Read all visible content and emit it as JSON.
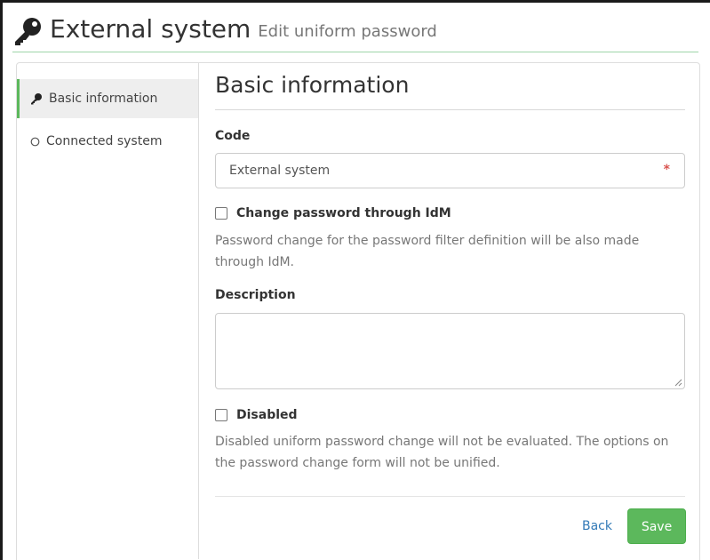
{
  "header": {
    "title": "External system",
    "subtitle": "Edit uniform password",
    "icon": "key-icon"
  },
  "sidebar": {
    "items": [
      {
        "label": "Basic information",
        "icon": "key-icon",
        "active": true
      },
      {
        "label": "Connected system",
        "icon": "circle-outline-icon",
        "active": false
      }
    ]
  },
  "form": {
    "title": "Basic information",
    "code": {
      "label": "Code",
      "value": "External system",
      "required_marker": "*"
    },
    "change_password": {
      "label": "Change password through IdM",
      "checked": false,
      "help": "Password change for the password filter definition will be also made through IdM."
    },
    "description": {
      "label": "Description",
      "value": ""
    },
    "disabled": {
      "label": "Disabled",
      "checked": false,
      "help": "Disabled uniform password change will not be evaluated. The options on the password change form will not be unified."
    },
    "buttons": {
      "back": "Back",
      "save": "Save"
    }
  },
  "colors": {
    "accent": "#5cb85c",
    "link": "#337ab7",
    "required": "#d9534f"
  }
}
